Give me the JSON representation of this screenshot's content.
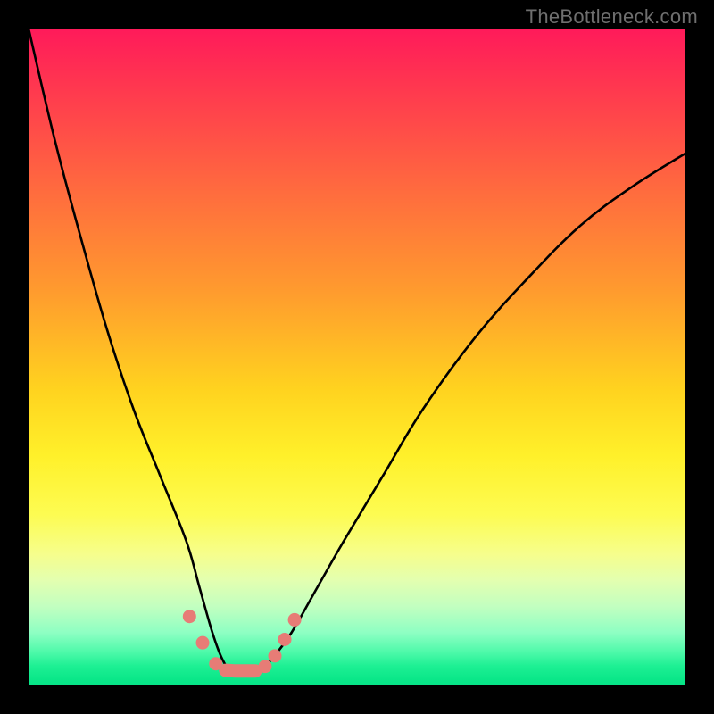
{
  "watermark": "TheBottleneck.com",
  "chart_data": {
    "type": "line",
    "title": "",
    "xlabel": "",
    "ylabel": "",
    "xlim": [
      0,
      100
    ],
    "ylim": [
      0,
      100
    ],
    "background_gradient": {
      "top": "#ff1a5a",
      "bottom": "#06e487",
      "meaning": "red high → green low (bottleneck severity)"
    },
    "series": [
      {
        "name": "bottleneck-curve",
        "x": [
          0,
          4,
          8,
          12,
          16,
          20,
          24,
          26,
          28,
          29.5,
          31,
          33,
          35,
          37,
          40,
          44,
          48,
          54,
          60,
          68,
          76,
          84,
          92,
          100
        ],
        "y": [
          100,
          83,
          68,
          54,
          42,
          32,
          22,
          15,
          8,
          4,
          2,
          2,
          2,
          4,
          8,
          15,
          22,
          32,
          42,
          53,
          62,
          70,
          76,
          81
        ]
      }
    ],
    "marker_points": {
      "comment": "salmon rounded markers near the valley",
      "x": [
        24.5,
        26.5,
        28.5,
        30,
        31.5,
        33,
        34.5,
        36,
        37.5,
        39,
        40.5
      ],
      "y": [
        10.5,
        6.5,
        3.3,
        2.3,
        2.2,
        2.2,
        2.2,
        2.9,
        4.5,
        7.0,
        10.0
      ]
    }
  }
}
